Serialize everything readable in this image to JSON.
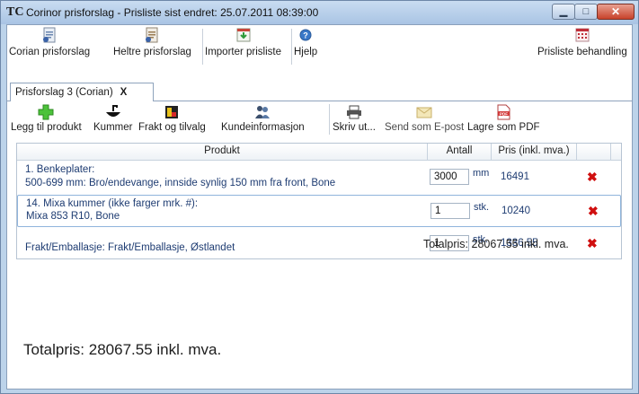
{
  "window": {
    "title": "Corinor prisforslag - Prisliste sist endret: 25.07.2011 08:39:00",
    "app_icon": "TC"
  },
  "topbar": {
    "buttons": [
      {
        "label": "Corian prisforslag",
        "icon": "document-icon"
      },
      {
        "label": "Heltre prisforslag",
        "icon": "document-icon"
      },
      {
        "label": "Importer prisliste",
        "icon": "import-icon"
      },
      {
        "label": "Hjelp",
        "icon": "help-icon"
      }
    ],
    "right_button": {
      "label": "Prisliste behandling",
      "icon": "calendar-icon"
    }
  },
  "tabs": [
    {
      "label": "Prisforslag 3 (Corian)",
      "close": "X"
    }
  ],
  "toolbar": {
    "items": [
      {
        "label": "Legg til produkt",
        "icon": "add-icon"
      },
      {
        "label": "Kummer",
        "icon": "sink-icon"
      },
      {
        "label": "Frakt og tilvalg",
        "icon": "options-icon"
      },
      {
        "label": "Kundeinformasjon",
        "icon": "customers-icon"
      },
      {
        "label": "Skriv ut...",
        "icon": "printer-icon"
      },
      {
        "label": "Send som E-post",
        "icon": "email-icon"
      },
      {
        "label": "Lagre som PDF",
        "icon": "pdf-icon"
      }
    ]
  },
  "table": {
    "headers": {
      "product": "Produkt",
      "qty": "Antall",
      "price": "Pris (inkl. mva.)"
    },
    "rows": [
      {
        "line1": "1. Benkeplater:",
        "line2": "500-699 mm: Bro/endevange, innside synlig 150 mm fra front, Bone",
        "qty": "3000",
        "unit": "mm",
        "price": "16491"
      },
      {
        "line1": "14. Mixa kummer (ikke farger mrk. #):",
        "line2": "Mixa 853 R10, Bone",
        "qty": "1",
        "unit": "stk.",
        "price": "10240"
      },
      {
        "line1": "",
        "line2": "Frakt/Emballasje: Frakt/Emballasje, Østlandet",
        "qty": "1",
        "unit": "stk.",
        "price": "1336.55"
      }
    ]
  },
  "totals": {
    "small": "Totalpris:  28067.55  inkl. mva.",
    "big": "Totalpris:  28067.55  inkl. mva."
  },
  "colors": {
    "accent": "#1e3c72",
    "delete": "#d01010",
    "chrome": "#bcd3ea"
  }
}
